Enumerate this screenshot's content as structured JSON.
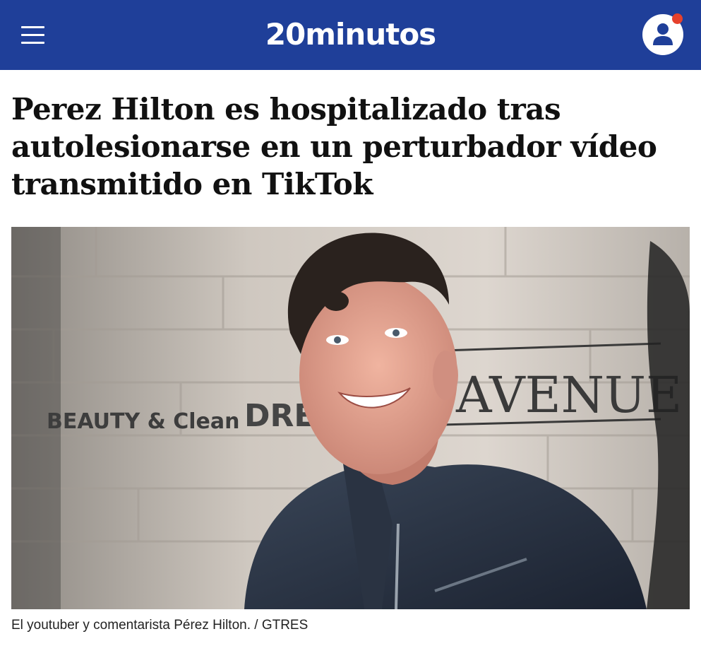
{
  "header": {
    "logo_text": "20minutos",
    "menu_icon": "hamburger-menu-icon",
    "account_icon": "user-account-icon",
    "background_color": "#1f3f99",
    "notification_dot_color": "#e6412c"
  },
  "article": {
    "headline": "Perez Hilton es hospitalizado tras autolesionarse en un perturbador vídeo transmitido en TikTok",
    "photo": {
      "wall_text": [
        "AVENUE",
        "BEAUTY & Clean",
        "DRE"
      ]
    },
    "caption": "El youtuber y comentarista Pérez Hilton. / GTRES"
  }
}
